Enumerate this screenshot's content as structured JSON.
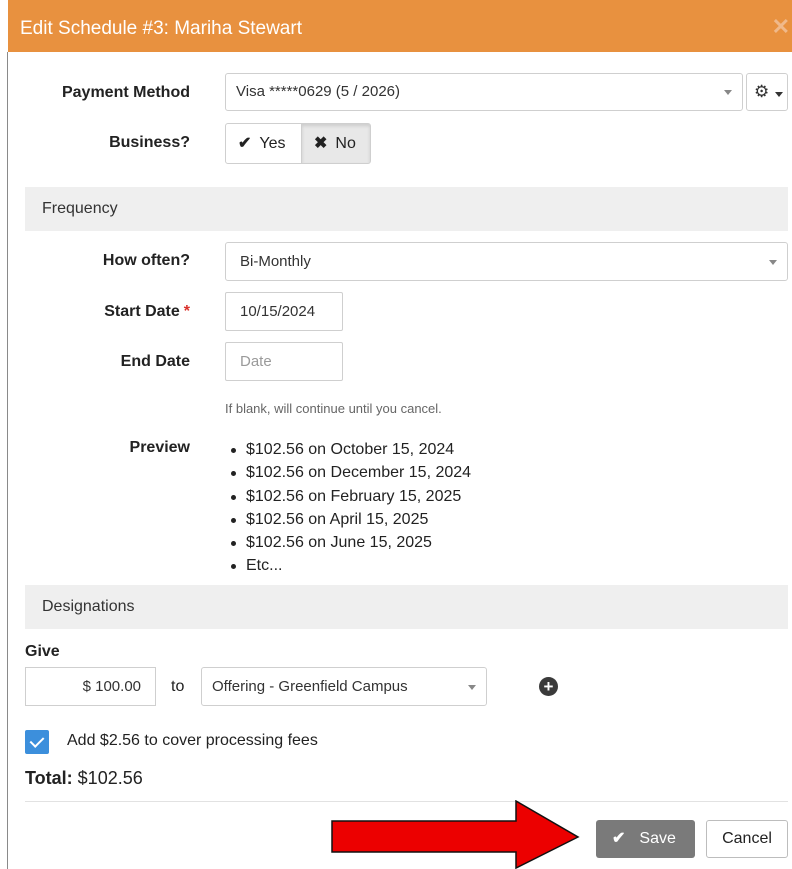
{
  "dialog": {
    "title": "Edit Schedule #3: Mariha Stewart",
    "close_glyph": "✕"
  },
  "payment": {
    "label": "Payment Method",
    "value": "Visa *****0629 (5 / 2026)",
    "gear_icon": "gear-icon"
  },
  "business": {
    "label": "Business?",
    "yes_label": "Yes",
    "no_label": "No",
    "selected": "No"
  },
  "frequency": {
    "section_label": "Frequency",
    "how_often_label": "How often?",
    "how_often_value": "Bi-Monthly",
    "start_label": "Start Date",
    "start_value": "10/15/2024",
    "end_label": "End Date",
    "end_placeholder": "Date",
    "end_help": "If blank, will continue until you cancel.",
    "preview_label": "Preview",
    "preview_items": [
      "$102.56 on October 15, 2024",
      "$102.56 on December 15, 2024",
      "$102.56 on February 15, 2025",
      "$102.56 on April 15, 2025",
      "$102.56 on June 15, 2025",
      "Etc..."
    ]
  },
  "designations": {
    "section_label": "Designations",
    "give_label": "Give",
    "amount": "$ 100.00",
    "to_label": "to",
    "fund": "Offering - Greenfield Campus"
  },
  "fees": {
    "checked": true,
    "label": "Add $2.56 to cover processing fees"
  },
  "total": {
    "label": "Total:",
    "value": "$102.56"
  },
  "footer": {
    "save_label": "Save",
    "cancel_label": "Cancel"
  },
  "colors": {
    "header": "#e8913f",
    "save_button": "#7a7a7a",
    "checkbox": "#3c8fdc",
    "annotation_arrow": "#ec0000"
  }
}
